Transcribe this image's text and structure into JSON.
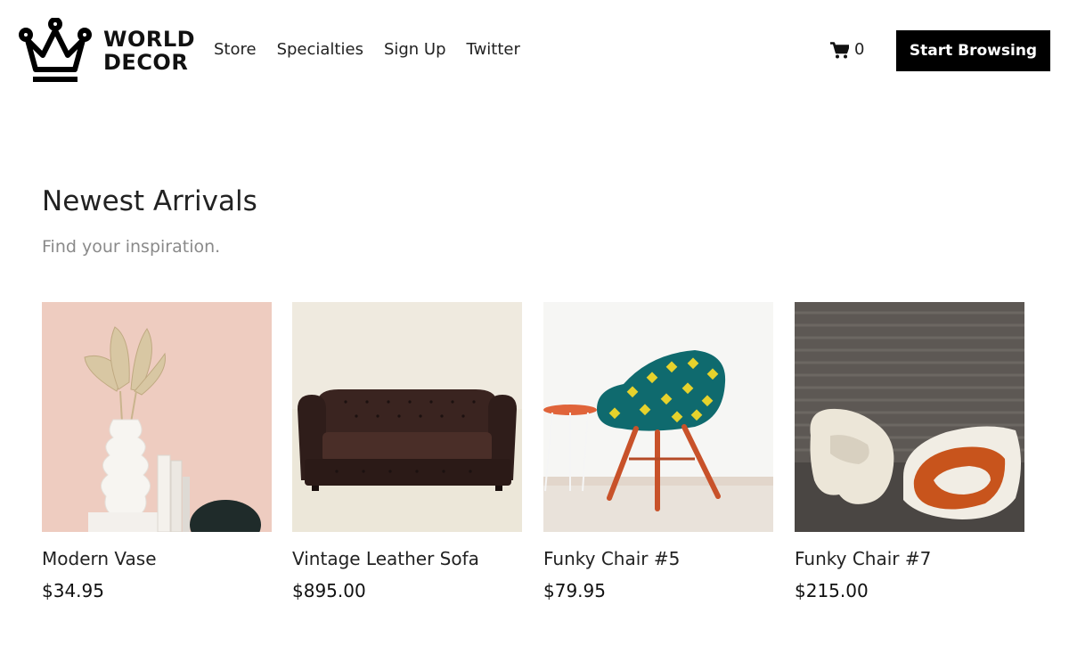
{
  "brand": {
    "line1": "WORLD",
    "line2": "DECOR",
    "logo_icon": "crown-icon"
  },
  "nav": {
    "items": [
      "Store",
      "Specialties",
      "Sign Up",
      "Twitter"
    ]
  },
  "cart": {
    "icon": "cart-icon",
    "count": "0"
  },
  "cta": {
    "label": "Start Browsing"
  },
  "section": {
    "title": "Newest Arrivals",
    "subtitle": "Find your inspiration."
  },
  "products": [
    {
      "name": "Modern Vase",
      "price": "$34.95",
      "image": "modern-vase-photo"
    },
    {
      "name": "Vintage Leather Sofa",
      "price": "$895.00",
      "image": "leather-sofa-photo"
    },
    {
      "name": "Funky Chair #5",
      "price": "$79.95",
      "image": "funky-chair-5-photo"
    },
    {
      "name": "Funky Chair #7",
      "price": "$215.00",
      "image": "funky-chair-7-photo"
    }
  ],
  "colors": {
    "cta_background": "#000000",
    "cta_text": "#ffffff",
    "subtitle_text": "#8a8a8a"
  }
}
